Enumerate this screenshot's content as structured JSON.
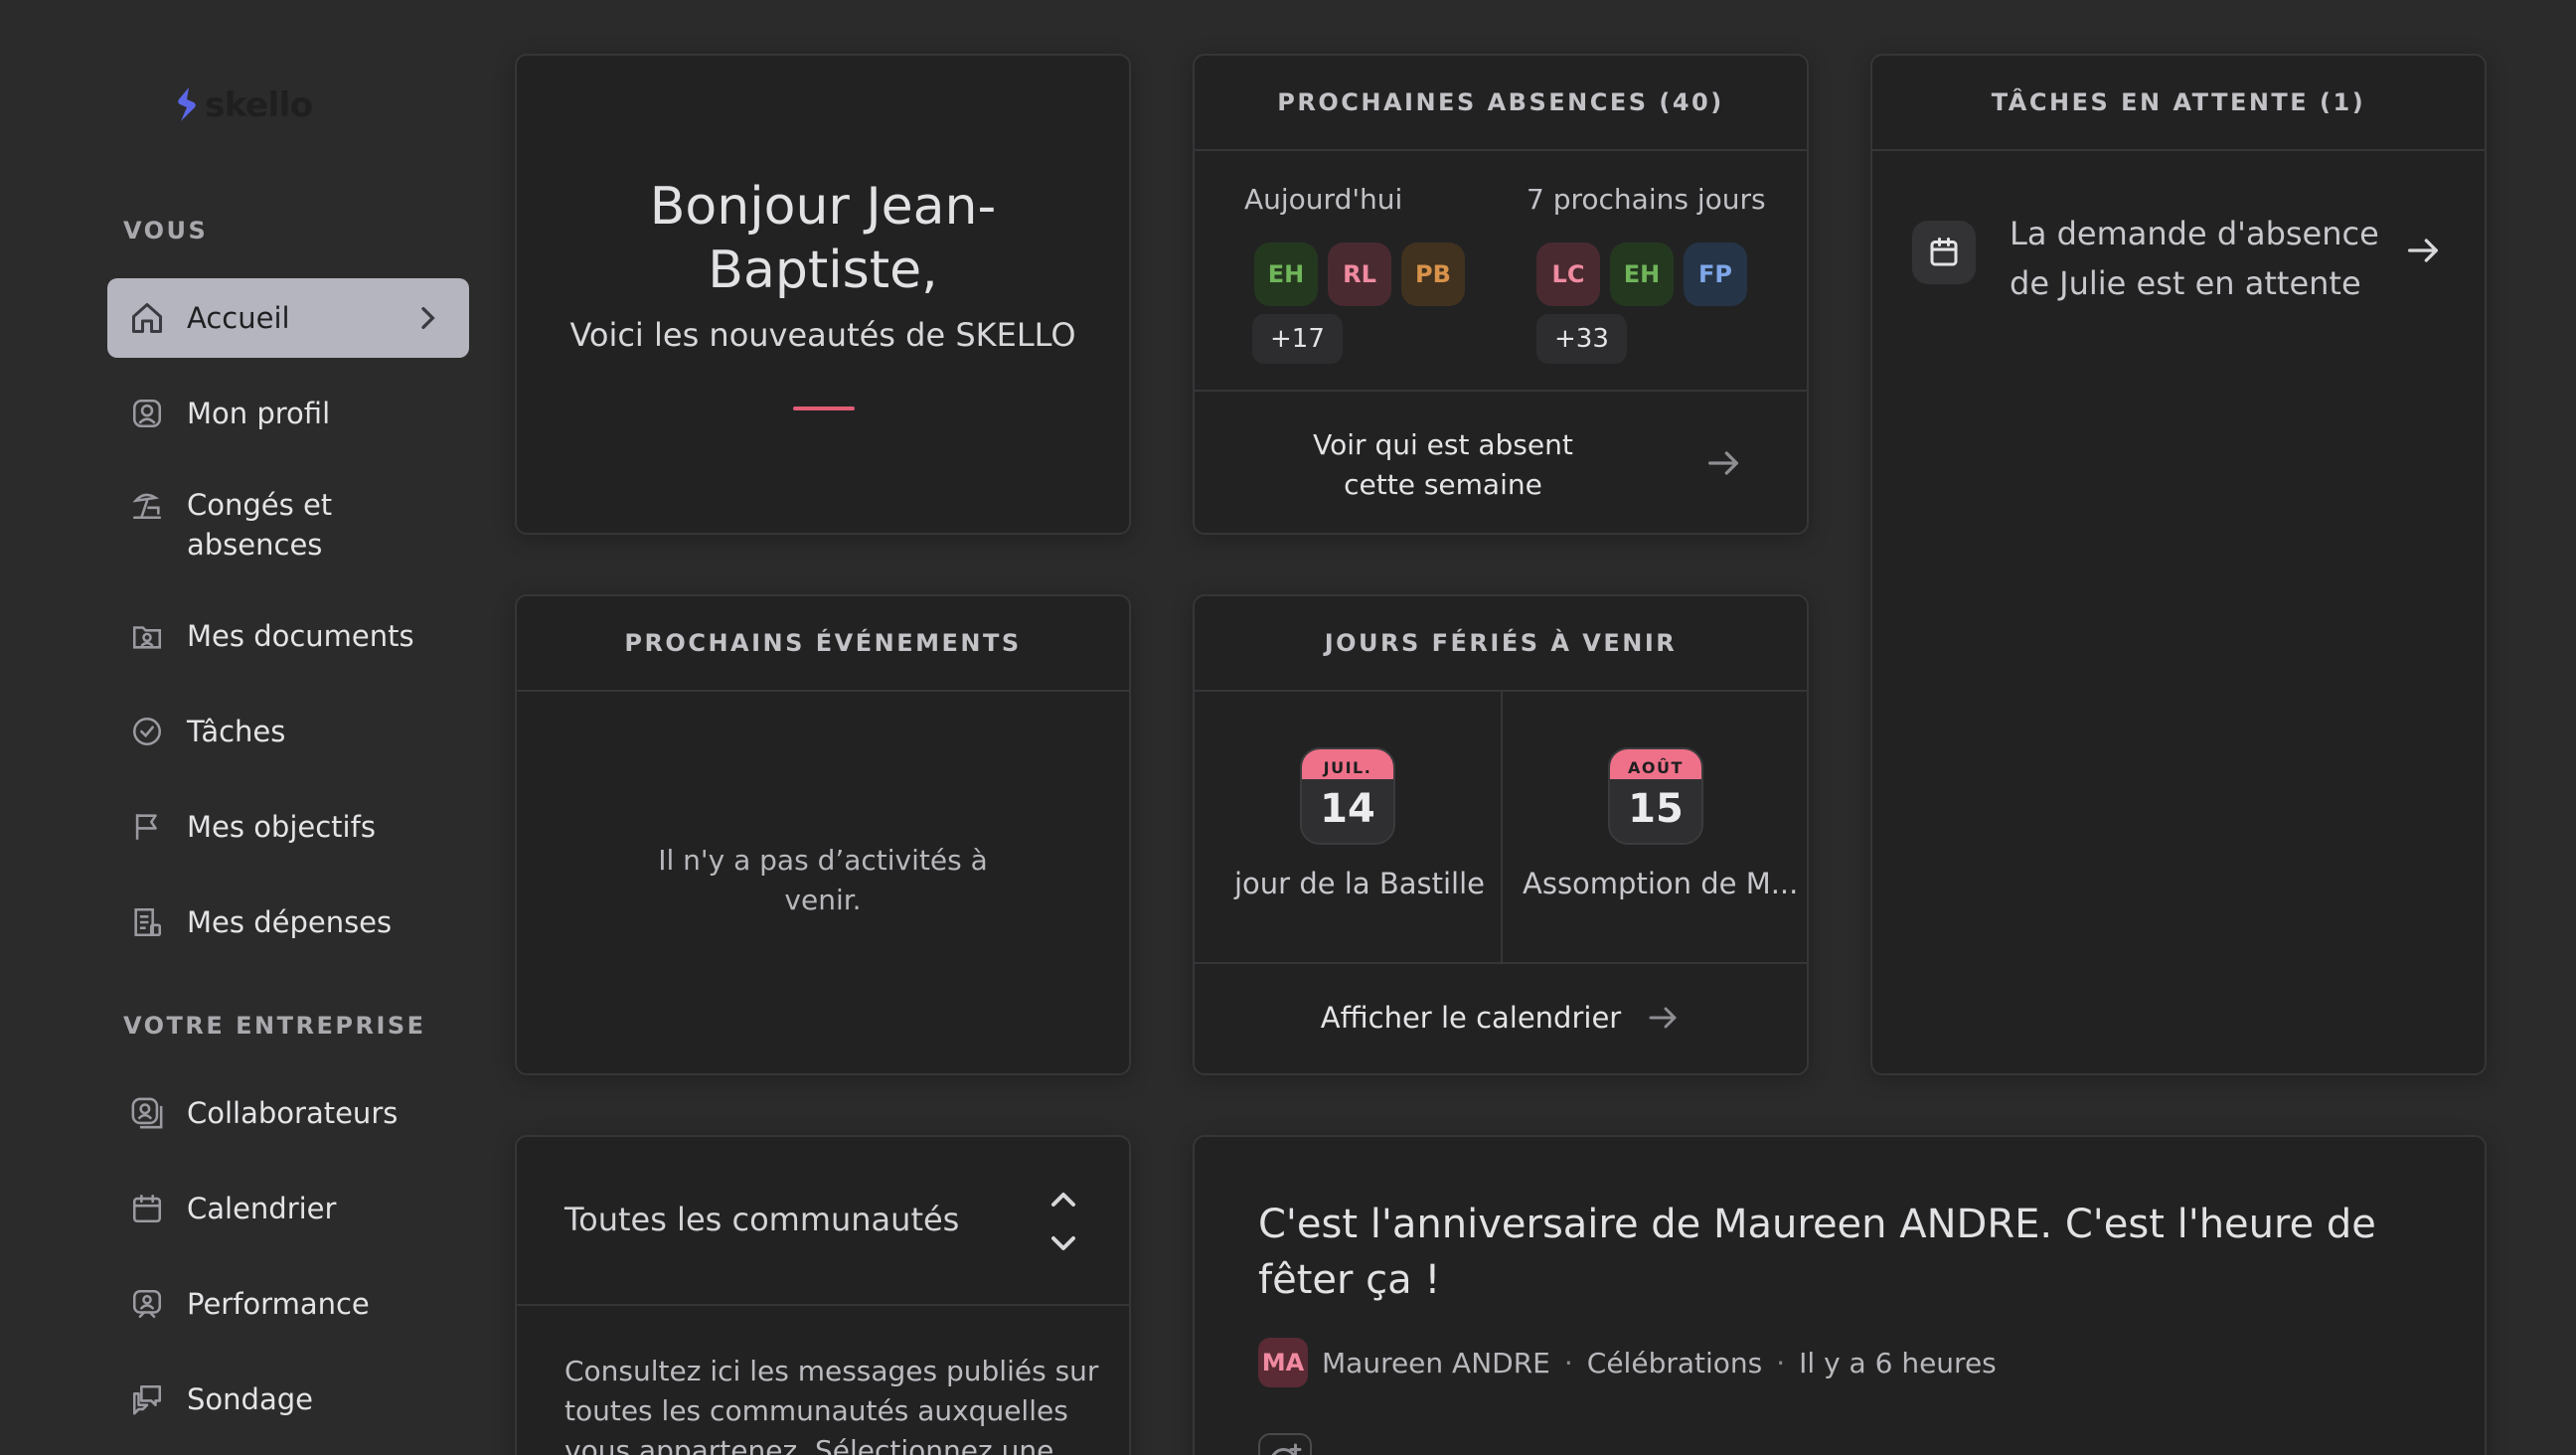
{
  "brand": {
    "name": "skello"
  },
  "sidebar": {
    "section_you": "VOUS",
    "section_company": "VOTRE ENTREPRISE",
    "items_you": [
      {
        "label": "Accueil",
        "icon": "home-icon",
        "active": true
      },
      {
        "label": "Mon profil",
        "icon": "profile-icon"
      },
      {
        "label": "Congés et absences",
        "icon": "beach-icon"
      },
      {
        "label": "Mes documents",
        "icon": "documents-icon"
      },
      {
        "label": "Tâches",
        "icon": "check-circle-icon"
      },
      {
        "label": "Mes objectifs",
        "icon": "flag-icon"
      },
      {
        "label": "Mes dépenses",
        "icon": "receipt-icon"
      }
    ],
    "items_company": [
      {
        "label": "Collaborateurs",
        "icon": "users-icon"
      },
      {
        "label": "Calendrier",
        "icon": "calendar-icon"
      },
      {
        "label": "Performance",
        "icon": "performance-icon"
      },
      {
        "label": "Sondage",
        "icon": "survey-icon"
      }
    ]
  },
  "welcome": {
    "title": "Bonjour Jean-Baptiste,",
    "subtitle": "Voici les nouveautés de SKELLO"
  },
  "absences": {
    "header": "PROCHAINES ABSENCES (40)",
    "today_label": "Aujourd'hui",
    "week_label": "7 prochains jours",
    "today_avatars": [
      {
        "initials": "EH",
        "bg": "#24381f",
        "fg": "#6fb55a"
      },
      {
        "initials": "RL",
        "bg": "#4a2a31",
        "fg": "#ef8aa0"
      },
      {
        "initials": "PB",
        "bg": "#40321f",
        "fg": "#d8924a"
      }
    ],
    "today_more": "+17",
    "week_avatars": [
      {
        "initials": "LC",
        "bg": "#4a2a31",
        "fg": "#ef8aa0"
      },
      {
        "initials": "EH",
        "bg": "#24381f",
        "fg": "#6fb55a"
      },
      {
        "initials": "FP",
        "bg": "#253446",
        "fg": "#7ea6e8"
      }
    ],
    "week_more": "+33",
    "footer_link": "Voir qui est absent cette semaine"
  },
  "tasks": {
    "header": "TÂCHES EN ATTENTE (1)",
    "item_text": "La demande d'absence de Julie est en attente"
  },
  "events": {
    "header": "PROCHAINS ÉVÉNEMENTS",
    "empty": "Il n'y a pas d’activités à venir."
  },
  "holidays": {
    "header": "JOURS FÉRIÉS À VENIR",
    "items": [
      {
        "month": "JUIL.",
        "day": "14",
        "name": "jour de la Bastille"
      },
      {
        "month": "AOÛT",
        "day": "15",
        "name": "Assomption de M..."
      }
    ],
    "footer_link": "Afficher le calendrier"
  },
  "communities": {
    "select_label": "Toutes les communautés",
    "description": "Consultez ici les messages publiés sur toutes les communautés auxquelles vous appartenez. Sélectionnez une"
  },
  "post": {
    "title": "C'est l'anniversaire de Maureen ANDRE. C'est l'heure de fêter ça !",
    "author_initials": "MA",
    "author": "Maureen ANDRE",
    "category": "Célébrations",
    "time": "Il y a 6 heures",
    "separator": "·"
  }
}
